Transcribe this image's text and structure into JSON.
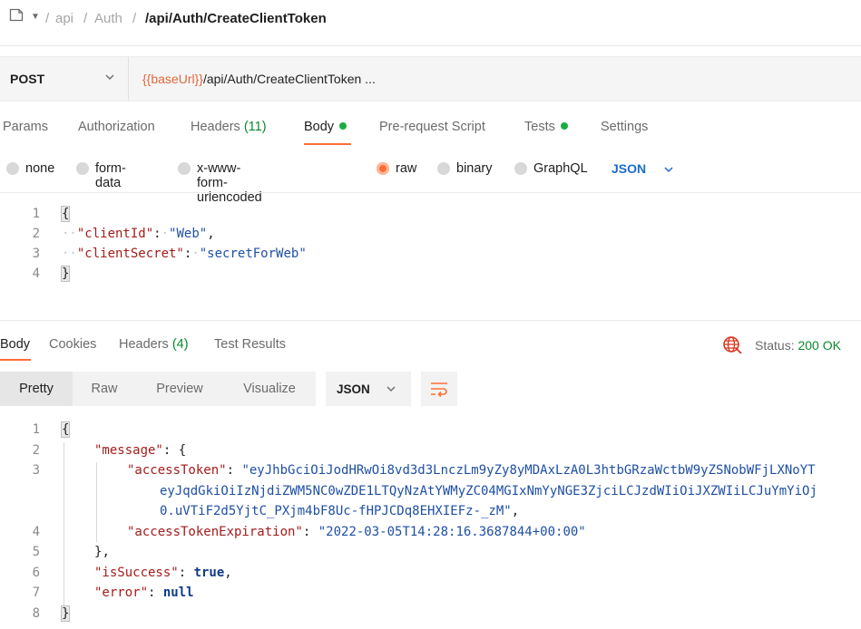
{
  "breadcrumb": {
    "items": [
      "api",
      "Auth"
    ],
    "separator": "/",
    "current": "/api/Auth/CreateClientToken"
  },
  "request": {
    "method": "POST",
    "url_variable": "{{baseUrl}}",
    "url_path": "/api/Auth/CreateClientToken ...",
    "tabs": {
      "params": "Params",
      "authorization": "Authorization",
      "headers": "Headers",
      "headers_count": "(11)",
      "body": "Body",
      "prerequest": "Pre-request Script",
      "tests": "Tests",
      "settings": "Settings"
    },
    "body_types": {
      "none": "none",
      "form_data": "form-data",
      "urlencoded": "x-www-form-urlencoded",
      "raw": "raw",
      "binary": "binary",
      "graphql": "GraphQL",
      "selected": "raw",
      "language": "JSON"
    },
    "body_lines": {
      "n1": "1",
      "n2": "2",
      "n3": "3",
      "n4": "4",
      "open": "{",
      "k1": "\"clientId\"",
      "v1": "\"Web\"",
      "k2": "\"clientSecret\"",
      "v2": "\"secretForWeb\"",
      "close": "}"
    }
  },
  "response": {
    "tabs": {
      "body": "Body",
      "cookies": "Cookies",
      "headers": "Headers",
      "headers_count": "(4)",
      "test_results": "Test Results"
    },
    "status_label": "Status:",
    "status_value": "200 OK",
    "views": {
      "pretty": "Pretty",
      "raw": "Raw",
      "preview": "Preview",
      "visualize": "Visualize",
      "format": "JSON"
    },
    "lines": {
      "n1": "1",
      "n2": "2",
      "n3": "3",
      "n4": "4",
      "n5": "5",
      "n6": "6",
      "n7": "7",
      "n8": "8",
      "open": "{",
      "message_key": "\"message\"",
      "message_open": "{",
      "token_key": "\"accessToken\"",
      "token_l1": "\"eyJhbGciOiJodHRwOi8vd3d3LnczLm9yZy8yMDAxLzA0L3htbGRzaWctbW9yZSNobWFjLXNoYT",
      "token_l2": "eyJqdGkiOiIzNjdiZWM5NC0wZDE1LTQyNzAtYWMyZC04MGIxNmYyNGE3ZjciLCJzdWIiOiJXZWIiLCJuYmYiOj",
      "token_l3": "0.uVTiF2d5YjtC_PXjm4bF8Uc-fHPJCDq8EHXIEFz-_zM\"",
      "exp_key": "\"accessTokenExpiration\"",
      "exp_value": "\"2022-03-05T14:28:16.3687844+00:00\"",
      "message_close": "}",
      "success_key": "\"isSuccess\"",
      "success_value": "true",
      "error_key": "\"error\"",
      "error_value": "null",
      "close": "}"
    }
  },
  "colors": {
    "accent": "#ff6c37",
    "success": "#1cab42",
    "link": "#1a6dcc"
  },
  "icons": {
    "collection": "document-icon",
    "method_dropdown": "chevron-down-icon",
    "network": "globe-icon",
    "wrap": "wrap-lines-icon"
  }
}
